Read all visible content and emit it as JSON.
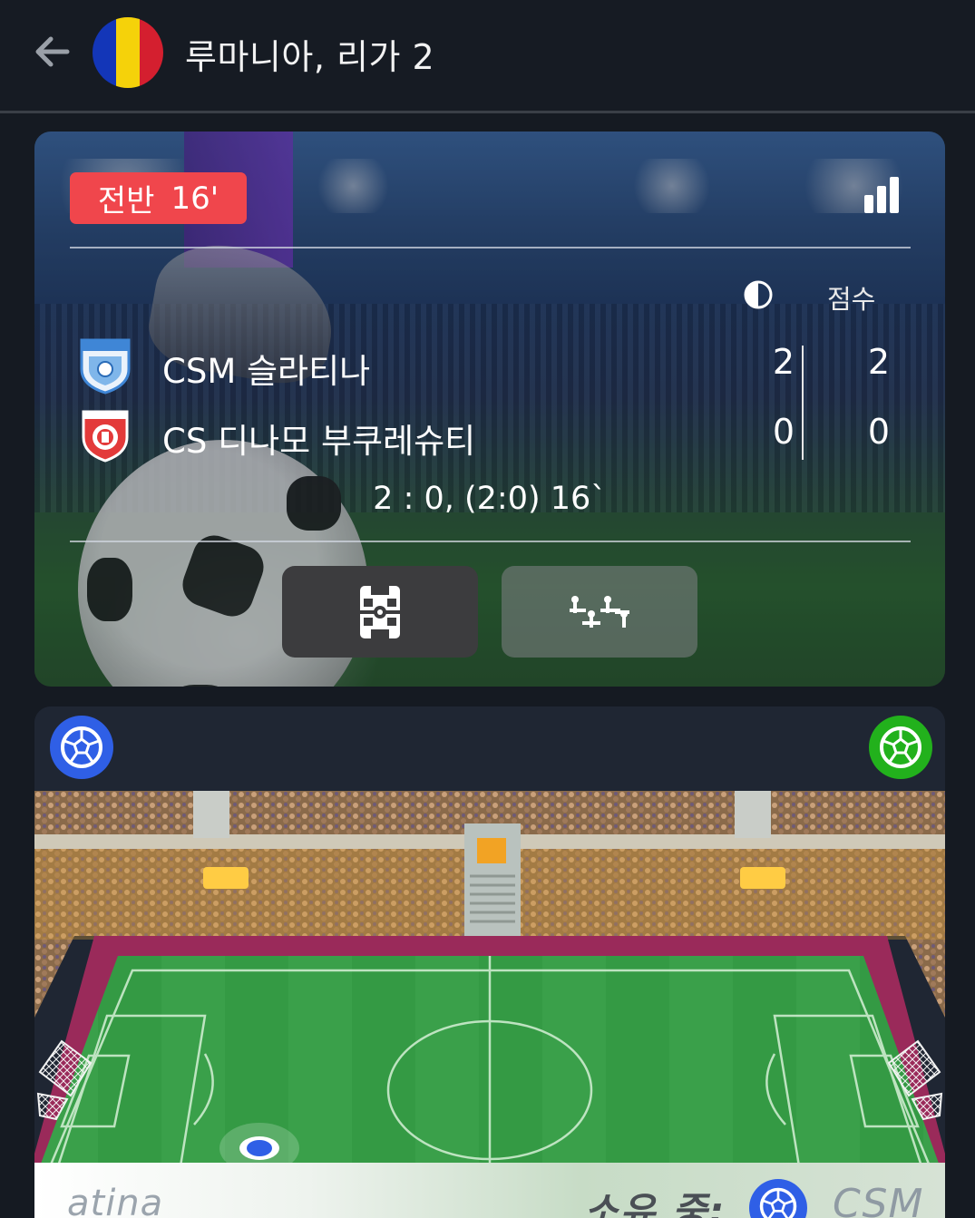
{
  "header": {
    "title": "루마니아, 리가 2",
    "flag_colors": [
      "#1336b8",
      "#f5d20a",
      "#d41f2f"
    ]
  },
  "scoreboard": {
    "period_label": "전반",
    "minute": "16'",
    "half_column_icon": "half-circle-icon",
    "score_column_label": "점수",
    "home": {
      "name": "CSM 슬라티나",
      "half_score": "2",
      "score": "2"
    },
    "away": {
      "name": "CS 디나모 부쿠레슈티",
      "half_score": "0",
      "score": "0"
    },
    "summary": "2 : 0, (2:0) 16`",
    "accent_color": "#f0464c"
  },
  "views": {
    "field_view_icon": "field-icon",
    "lineup_view_icon": "lineup-icon"
  },
  "pitch": {
    "home_button_icon": "soccer-ball-icon",
    "away_button_icon": "soccer-ball-icon",
    "home_color": "#2f5fe6",
    "away_color": "#22b11c"
  },
  "ticker": {
    "left_text": "atina",
    "possession_label": "소유 중:",
    "team_text": "CSM"
  }
}
